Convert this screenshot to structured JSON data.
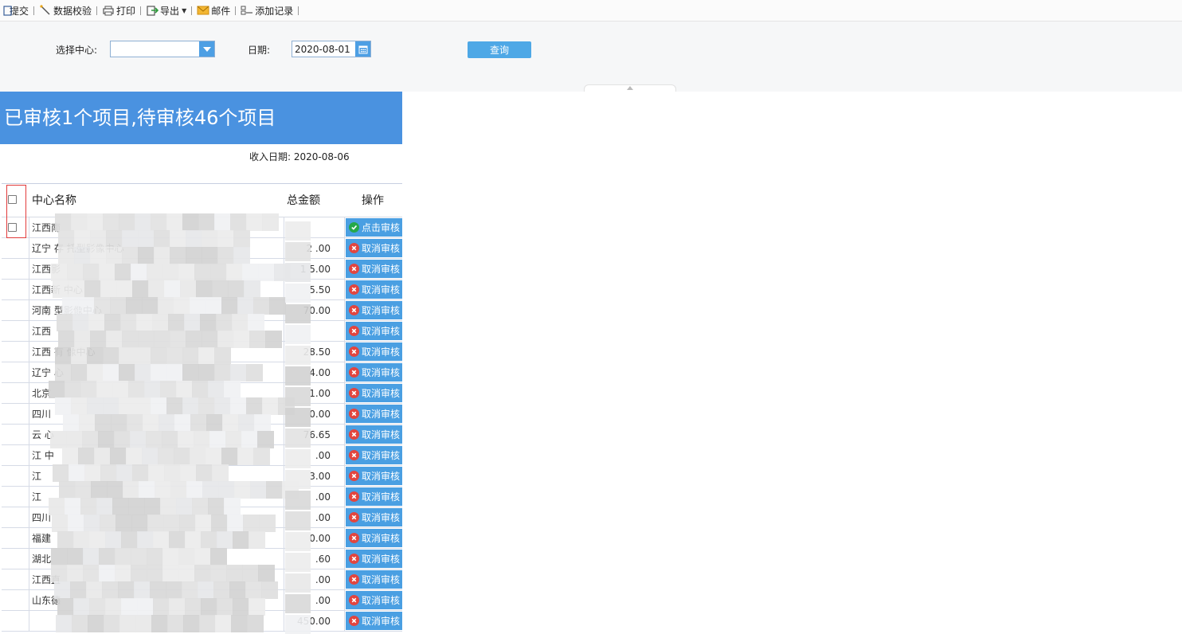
{
  "toolbar": {
    "items": [
      {
        "label": "提交",
        "icon": "submit-icon"
      },
      {
        "label": "数据校验",
        "icon": "wand-icon"
      },
      {
        "label": "打印",
        "icon": "printer-icon"
      },
      {
        "label": "导出",
        "icon": "export-icon",
        "dropdown": true
      },
      {
        "label": "邮件",
        "icon": "mail-icon"
      },
      {
        "label": "添加记录",
        "icon": "add-record-icon"
      }
    ]
  },
  "filter": {
    "center_label": "选择中心:",
    "center_value": "",
    "date_label": "日期:",
    "date_value": "2020-08-01",
    "query_label": "查询"
  },
  "banner": {
    "title": "已审核1个项目,待审核46个项目"
  },
  "receive_date": "收入日期: 2020-08-06",
  "table": {
    "headers": {
      "name": "中心名称",
      "amount": "总金额",
      "action": "操作"
    },
    "rows": [
      {
        "name": "江西南",
        "amount": "",
        "action": "点击审核",
        "status": "approve",
        "has_check": true
      },
      {
        "name": "辽宁  存                    托型影像中心",
        "amount": "2      .00",
        "action": "取消审核",
        "status": "cancel"
      },
      {
        "name": "江西影",
        "amount": "1      5.00",
        "action": "取消审核",
        "status": "cancel"
      },
      {
        "name": "江西新                       中心",
        "amount": "5.50",
        "action": "取消审核",
        "status": "cancel"
      },
      {
        "name": "河南                       型影像中心",
        "amount": "70.00",
        "action": "取消审核",
        "status": "cancel"
      },
      {
        "name": "江西",
        "amount": "",
        "action": "取消审核",
        "status": "cancel"
      },
      {
        "name": "江西              有         像中心",
        "amount": "28.50",
        "action": "取消审核",
        "status": "cancel"
      },
      {
        "name": "辽宁             心",
        "amount": "4.00",
        "action": "取消审核",
        "status": "cancel"
      },
      {
        "name": "北京",
        "amount": "1.00",
        "action": "取消审核",
        "status": "cancel"
      },
      {
        "name": "四川",
        "amount": "0.00",
        "action": "取消审核",
        "status": "cancel"
      },
      {
        "name": "云                              心",
        "amount": "76.65",
        "action": "取消审核",
        "status": "cancel"
      },
      {
        "name": "江                    中",
        "amount": ".00",
        "action": "取消审核",
        "status": "cancel"
      },
      {
        "name": "江",
        "amount": "3.00",
        "action": "取消审核",
        "status": "cancel"
      },
      {
        "name": "江",
        "amount": ".00",
        "action": "取消审核",
        "status": "cancel"
      },
      {
        "name": "四川",
        "amount": ".00",
        "action": "取消审核",
        "status": "cancel"
      },
      {
        "name": "福建",
        "amount": "0.00",
        "action": "取消审核",
        "status": "cancel"
      },
      {
        "name": "湖北",
        "amount": ".60",
        "action": "取消审核",
        "status": "cancel"
      },
      {
        "name": "江西直",
        "amount": ".00",
        "action": "取消审核",
        "status": "cancel"
      },
      {
        "name": "山东德",
        "amount": ".00",
        "action": "取消审核",
        "status": "cancel"
      },
      {
        "name": "",
        "amount": "450.00",
        "action": "取消审核",
        "status": "cancel"
      }
    ]
  },
  "colors": {
    "banner": "#4a92e0",
    "button": "#4a9fe2",
    "approve": "#25a84a",
    "cancel": "#e2453f",
    "highlight_frame": "#e23b3b"
  }
}
